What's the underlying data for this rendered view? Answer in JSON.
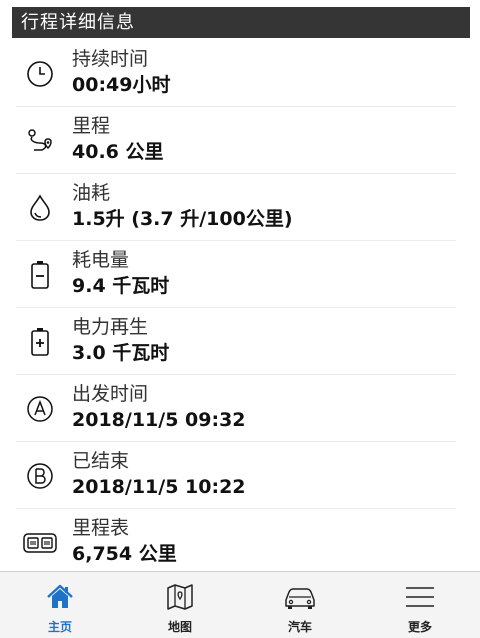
{
  "header": {
    "title": "行程详细信息"
  },
  "rows": [
    {
      "icon": "clock-icon",
      "label": "持续时间",
      "value": "00:49小时"
    },
    {
      "icon": "route-icon",
      "label": "里程",
      "value": "40.6 公里"
    },
    {
      "icon": "fuel-drop-icon",
      "label": "油耗",
      "value": "1.5升 (3.7 升/100公里)"
    },
    {
      "icon": "battery-minus-icon",
      "label": "耗电量",
      "value": "9.4 千瓦时"
    },
    {
      "icon": "battery-plus-icon",
      "label": "电力再生",
      "value": "3.0 千瓦时"
    },
    {
      "icon": "circle-a-icon",
      "label": "出发时间",
      "value": "2018/11/5 09:32"
    },
    {
      "icon": "circle-b-icon",
      "label": "已结束",
      "value": "2018/11/5 10:22"
    },
    {
      "icon": "odometer-icon",
      "label": "里程表",
      "value": "6,754 公里"
    }
  ],
  "tabs": [
    {
      "icon": "home-icon",
      "label": "主页",
      "active": true
    },
    {
      "icon": "map-icon",
      "label": "地图",
      "active": false
    },
    {
      "icon": "car-icon",
      "label": "汽车",
      "active": false
    },
    {
      "icon": "menu-icon",
      "label": "更多",
      "active": false
    }
  ],
  "colors": {
    "header_bg": "#353535",
    "accent": "#1e73c8",
    "tabbar_bg": "#f4f4f4"
  }
}
